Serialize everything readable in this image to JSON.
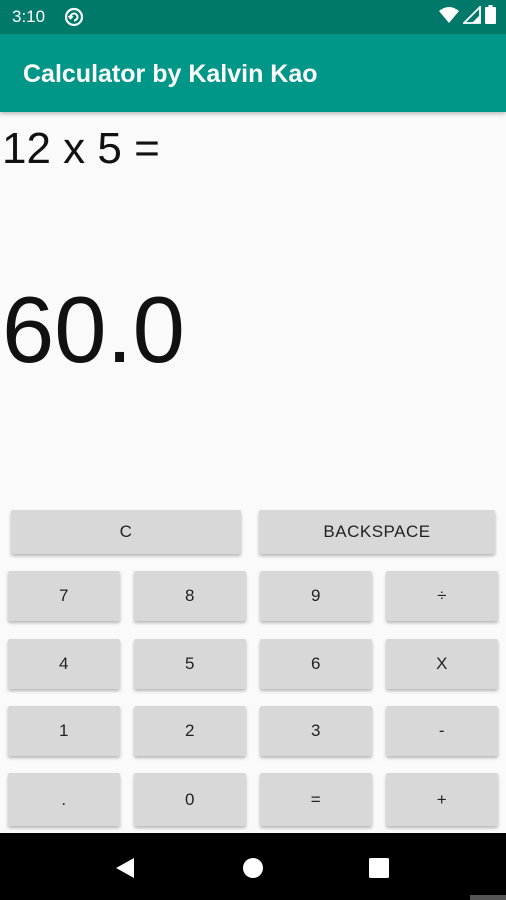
{
  "status_bar": {
    "time": "3:10",
    "icons": [
      "sync-icon",
      "wifi-icon",
      "cell-signal-icon",
      "battery-icon"
    ],
    "color": "#00796b"
  },
  "app_bar": {
    "title": "Calculator by Kalvin Kao",
    "color": "#009688"
  },
  "display": {
    "expression": "12 x 5 =",
    "result": "60.0"
  },
  "keypad": {
    "clear": "C",
    "backspace": "BACKSPACE",
    "seven": "7",
    "eight": "8",
    "nine": "9",
    "divide": "÷",
    "four": "4",
    "five": "5",
    "six": "6",
    "multiply": "X",
    "one": "1",
    "two": "2",
    "three": "3",
    "minus": "-",
    "decimal": ".",
    "zero": "0",
    "equals": "=",
    "plus": "+",
    "button_color": "#d8d8d8"
  },
  "nav_bar": {
    "icons": [
      "back-icon",
      "home-icon",
      "recents-icon"
    ]
  }
}
